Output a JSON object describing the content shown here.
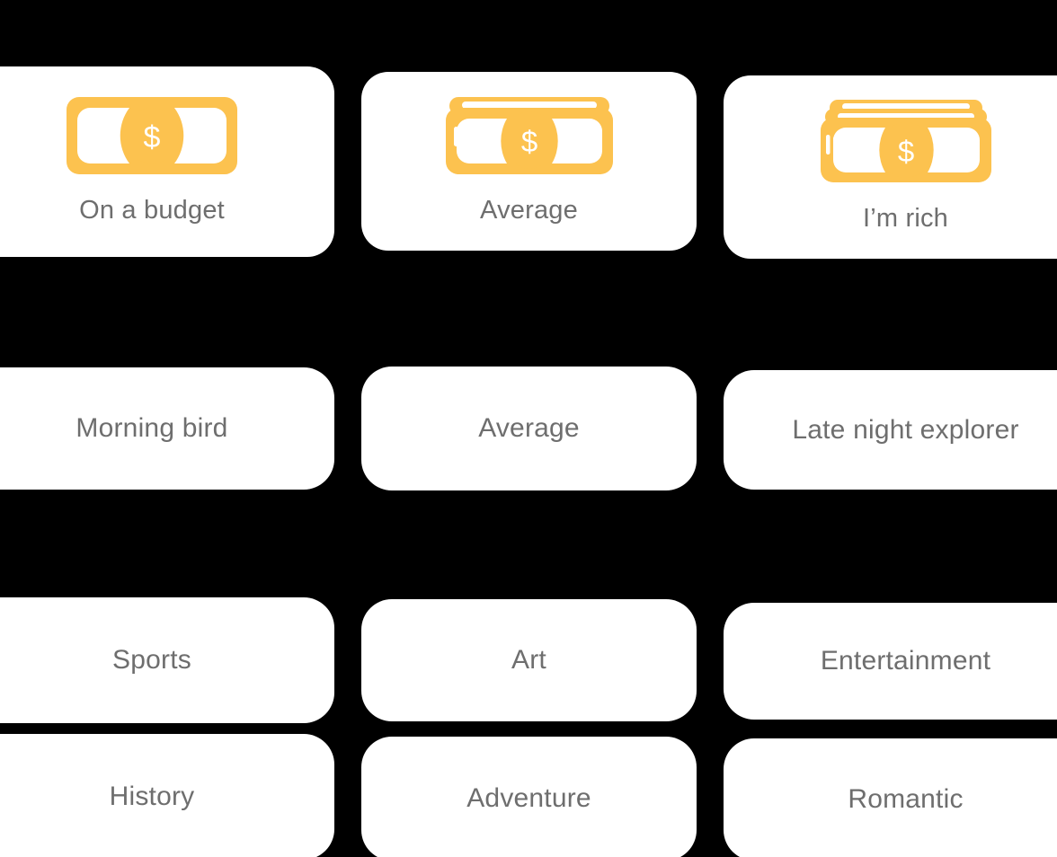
{
  "theme": {
    "background": "#000000",
    "card_background": "#ffffff",
    "accent": "#fcc24f",
    "label_color": "#6e6e6e"
  },
  "groups": [
    {
      "name": "budget",
      "options": [
        {
          "label": "On a budget",
          "icon": "money-bill-single-icon",
          "bills": 1
        },
        {
          "label": "Average",
          "icon": "money-bill-stack-2-icon",
          "bills": 2
        },
        {
          "label": "I’m rich",
          "icon": "money-bill-stack-3-icon",
          "bills": 3
        }
      ]
    },
    {
      "name": "schedule",
      "options": [
        {
          "label": "Morning bird"
        },
        {
          "label": "Average"
        },
        {
          "label": "Late night explorer"
        }
      ]
    },
    {
      "name": "interests",
      "options": [
        {
          "label": "Sports"
        },
        {
          "label": "Art"
        },
        {
          "label": "Entertainment"
        },
        {
          "label": "History"
        },
        {
          "label": "Adventure"
        },
        {
          "label": "Romantic"
        }
      ]
    }
  ]
}
